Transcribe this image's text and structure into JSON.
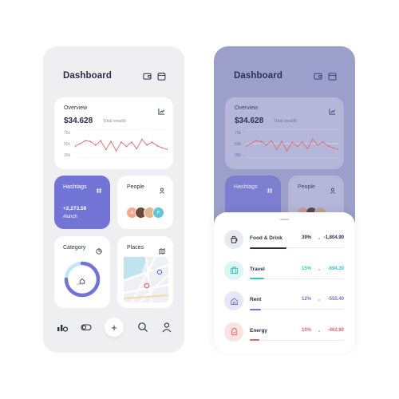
{
  "dashboard": {
    "title": "Dashboard",
    "overview": {
      "title": "Overview",
      "total_value": "$34.628",
      "total_label": "Total wealth",
      "yticks": [
        "75k",
        "55k",
        "35k"
      ]
    },
    "hashtags": {
      "title": "Hashtags",
      "value": "+2,273.59",
      "tag": "#lunch"
    },
    "people": {
      "title": "People",
      "avatars": [
        "A",
        "",
        "",
        "P"
      ]
    },
    "category": {
      "title": "Category",
      "center_label": "yard",
      "progress": 0.75
    },
    "places": {
      "title": "Places"
    }
  },
  "colors": {
    "accent": "#7275d6",
    "chart_line": "#e06d6d",
    "food": "#2b2f44",
    "travel": "#35c4c8",
    "rent": "#7275d6",
    "energy": "#e56464"
  },
  "nav": {
    "items": [
      "stats-icon",
      "toggle-icon",
      "plus-icon",
      "search-icon",
      "profile-icon"
    ],
    "plus": "+"
  },
  "chart_data": {
    "type": "line",
    "x": [
      0,
      1,
      2,
      3,
      4,
      5,
      6,
      7,
      8,
      9,
      10,
      11,
      12,
      13,
      14,
      15,
      16,
      17,
      18
    ],
    "values": [
      51,
      55,
      59,
      58,
      53,
      59,
      47,
      58,
      45,
      57,
      51,
      57,
      48,
      61,
      53,
      57,
      52,
      49,
      47
    ],
    "yticks": [
      "75k",
      "55k",
      "35k"
    ],
    "ylim": [
      35,
      75
    ],
    "grid": true
  },
  "expenses": [
    {
      "label": "Food & Drink",
      "pct": "39%",
      "amount": "-1,804.90",
      "fraction": 0.39,
      "color": "#2b2f44",
      "bg": "#e9eaf0",
      "icon": "cup-icon"
    },
    {
      "label": "Travel",
      "pct": "15%",
      "amount": "-694.20",
      "fraction": 0.15,
      "color": "#35c4c8",
      "bg": "#dff4f5",
      "icon": "suitcase-icon"
    },
    {
      "label": "Rent",
      "pct": "12%",
      "amount": "-555.40",
      "fraction": 0.12,
      "color": "#7275d6",
      "bg": "#e6e7f8",
      "icon": "house-icon"
    },
    {
      "label": "Energy",
      "pct": "10%",
      "amount": "-462.80",
      "fraction": 0.1,
      "color": "#e56464",
      "bg": "#fbe3e3",
      "icon": "energy-icon"
    }
  ]
}
